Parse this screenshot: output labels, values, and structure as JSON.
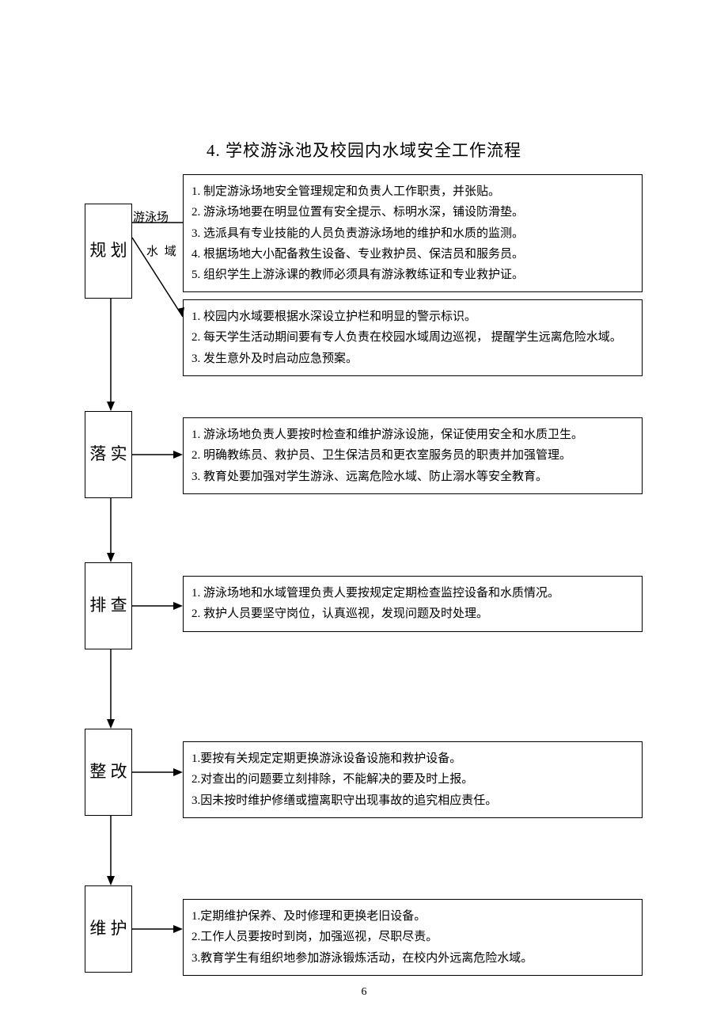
{
  "title": "4. 学校游泳池及校园内水域安全工作流程",
  "page_number": "6",
  "labels": {
    "pool": "游泳场",
    "water": "水 域"
  },
  "steps": {
    "s1": {
      "name": "规 划"
    },
    "s2": {
      "name": "落 实"
    },
    "s3": {
      "name": "排 查"
    },
    "s4": {
      "name": "整 改"
    },
    "s5": {
      "name": "维 护"
    }
  },
  "blocks": {
    "b1a": [
      "1. 制定游泳场地安全管理规定和负责人工作职责，并张贴。",
      "2. 游泳场地要在明显位置有安全提示、标明水深，铺设防滑垫。",
      "3. 选派具有专业技能的人员负责游泳场地的维护和水质的监测。",
      "4. 根据场地大小配备救生设备、专业救护员、保洁员和服务员。",
      "5. 组织学生上游泳课的教师必须具有游泳教练证和专业救护证。"
    ],
    "b1b": [
      "1. 校园内水域要根据水深设立护栏和明显的警示标识。",
      "2. 每天学生活动期间要有专人负责在校园水域周边巡视， 提醒学生远离危险水域。",
      "3. 发生意外及时启动应急预案。"
    ],
    "b2": [
      "1. 游泳场地负责人要按时检查和维护游泳设施，保证使用安全和水质卫生。",
      "2. 明确教练员、救护员、卫生保洁员和更衣室服务员的职责并加强管理。",
      "3. 教育处要加强对学生游泳、远离危险水域、防止溺水等安全教育。"
    ],
    "b3": [
      "1. 游泳场地和水域管理负责人要按规定定期检查监控设备和水质情况。",
      "2. 救护人员要坚守岗位，认真巡视，发现问题及时处理。"
    ],
    "b4": [
      "1.要按有关规定定期更换游泳设备设施和救护设备。",
      "2.对查出的问题要立刻排除，不能解决的要及时上报。",
      "3.因未按时维护修缮或擅离职守出现事故的追究相应责任。"
    ],
    "b5": [
      "1.定期维护保养、及时修理和更换老旧设备。",
      "2.工作人员要按时到岗，加强巡视，尽职尽责。",
      "3.教育学生有组织地参加游泳锻炼活动，在校内外远离危险水域。"
    ]
  }
}
